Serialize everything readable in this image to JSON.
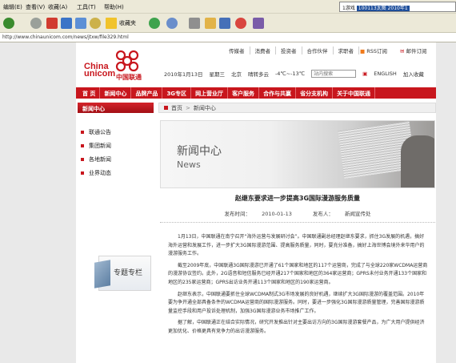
{
  "browser": {
    "menu": [
      "编辑(E)",
      "查看(V)",
      "收藏(A)",
      "工具(T)",
      "帮助(H)"
    ],
    "status_text_prefix": "1游戏",
    "status_text_highlight": "100113太图 2010年1",
    "toolbar": {
      "favorites_label": "收藏夹"
    },
    "address": "http://www.chinaunicom.com/news/jtxw/file329.html"
  },
  "site": {
    "logo": {
      "en_line1": "China",
      "en_line2": "unicom",
      "cn": "中国联通"
    },
    "top_links": [
      "传媒者",
      "消费者",
      "投资者",
      "合作伙伴",
      "求职者"
    ],
    "rss_label": "RSS订阅",
    "mail_label": "邮件订阅",
    "info": {
      "date": "2010年1月13日",
      "weekday": "星期三",
      "city": "北京",
      "weather": "晴转多云",
      "temperature": "-4℃~-13℃",
      "search_placeholder": "站内搜索",
      "lang": "ENGLISH",
      "bookmark": "加入收藏"
    },
    "nav": [
      "首 页",
      "新闻中心",
      "品牌产品",
      "3G专区",
      "网上营业厅",
      "客户服务",
      "合作与共赢",
      "省分支机构",
      "关于中国联通"
    ],
    "sidebar": {
      "title": "新闻中心",
      "items": [
        "联通公告",
        "集团新闻",
        "各地新闻",
        "业界动态"
      ],
      "special_label": "专题专栏"
    },
    "breadcrumb": [
      "首页",
      "新闻中心"
    ],
    "banner": {
      "title_cn": "新闻中心",
      "title_en": "News"
    },
    "article": {
      "title": "赵继东要求进一步提高3G国际漫游服务质量",
      "publish_label": "发布时间：",
      "publish_date": "2010-01-13",
      "source_label": "发布人：",
      "source": "新闻宣传处",
      "paragraphs": [
        "1月13日，中国联通在南宁召开“海外运营与发展研讨会”。中国联通副总经理赵继东要求，抓住3G发展的机遇，搞好海外运营和发展工作，进一步扩大3G国际漫游范围、提高服务质量，同时，要充分准备，搞好上海世博会境外来华用户的漫游服务工作。",
        "截至2009年底，中国联通3G国际漫游已开通了61个国家和地区的117个运营商，完成了与全球220家WCDMA运营商的漫游协议签约。此外，2G语音和短信服务已经开通217个国家和地区的364家运营商；GPRS未付业务开通133个国家和地区的235家运营商；GPRS出访业务开通113个国家和地区的190家运营商。",
        "赵继东表示，中国联通要抓住全球WCDMA制式3G市场发展的良好机遇，继续扩大3G国际漫游的覆盖范围。2010年要为争开通全部具备条件的WCDMA运营商的国际漫游服务。同时，要进一步强化3G国际漫游质量管理，完善国际漫游质量监控手段和用户投诉处理机制，加强3G国际漫游业务市场推广工作。",
        "据了解，中国联通正在结合实际情况，研究开发推出针对主要出访方向的3G国际漫游套餐产品，为广大用户提供经济更加优化、价格更具有竞争力的出访漫游服务。"
      ]
    }
  }
}
